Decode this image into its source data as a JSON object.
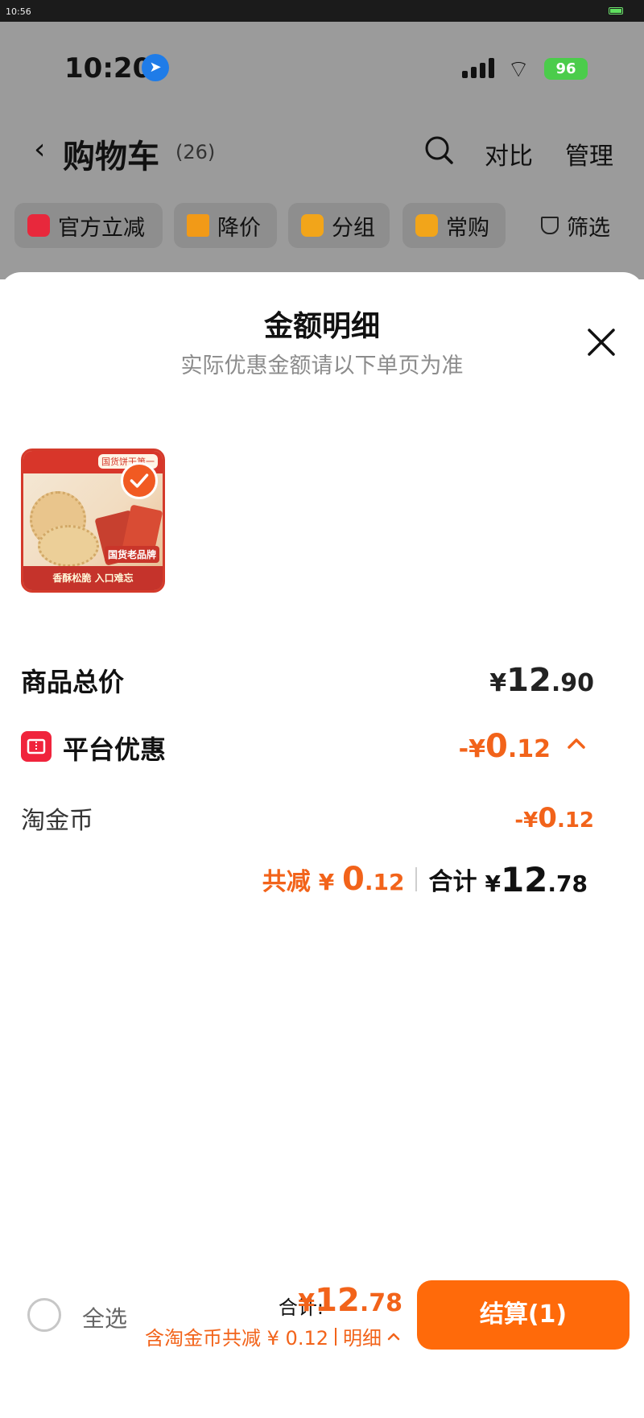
{
  "outer_status": {
    "time": "10:56"
  },
  "phone_status": {
    "time": "10:20",
    "battery": "96"
  },
  "nav": {
    "title": "购物车",
    "count": "(26)",
    "compare": "对比",
    "manage": "管理"
  },
  "filters": [
    {
      "label": "官方立减",
      "icon": "flash-icon",
      "color": "#e8283c"
    },
    {
      "label": "降价",
      "icon": "arrow-down-icon",
      "color": "#f29a17"
    },
    {
      "label": "分组",
      "icon": "folder-icon",
      "color": "#f2a51a"
    },
    {
      "label": "常购",
      "icon": "bag-icon",
      "color": "#f2a51a"
    },
    {
      "label": "筛选",
      "icon": "filter-icon",
      "color": "#222222"
    }
  ],
  "sheet": {
    "title": "金额明细",
    "subtitle": "实际优惠金额请以下单页为准",
    "product": {
      "tag": "国货老品牌",
      "bottom_text": "香酥松脆 入口难忘",
      "brand_text": "国货饼干第一"
    },
    "goods_total": {
      "label": "商品总价",
      "currency": "¥",
      "int": "12",
      "dec": ".90"
    },
    "platform_discount": {
      "label": "平台优惠",
      "prefix": "-¥",
      "int": "0",
      "dec": ".12"
    },
    "coin": {
      "label": "淘金币",
      "prefix": "-¥",
      "int": "0",
      "dec": ".12"
    },
    "summary": {
      "discount_label": "共减",
      "discount_currency": "¥",
      "discount_int": "0",
      "discount_dec": ".12",
      "total_label": "合计",
      "total_currency": "¥",
      "total_int": "12",
      "total_dec": ".78"
    }
  },
  "bottom_bar": {
    "select_all": "全选",
    "total_label": "合计:",
    "total_currency": "¥",
    "total_int": "12",
    "total_dec": ".78",
    "detail_text": "含淘金币共减 ¥ 0.12",
    "detail_link": "明细",
    "checkout": "结算(1)"
  },
  "colors": {
    "accent": "#ff6a0a",
    "discount": "#f2631a",
    "promo_icon": "#f0243c"
  }
}
